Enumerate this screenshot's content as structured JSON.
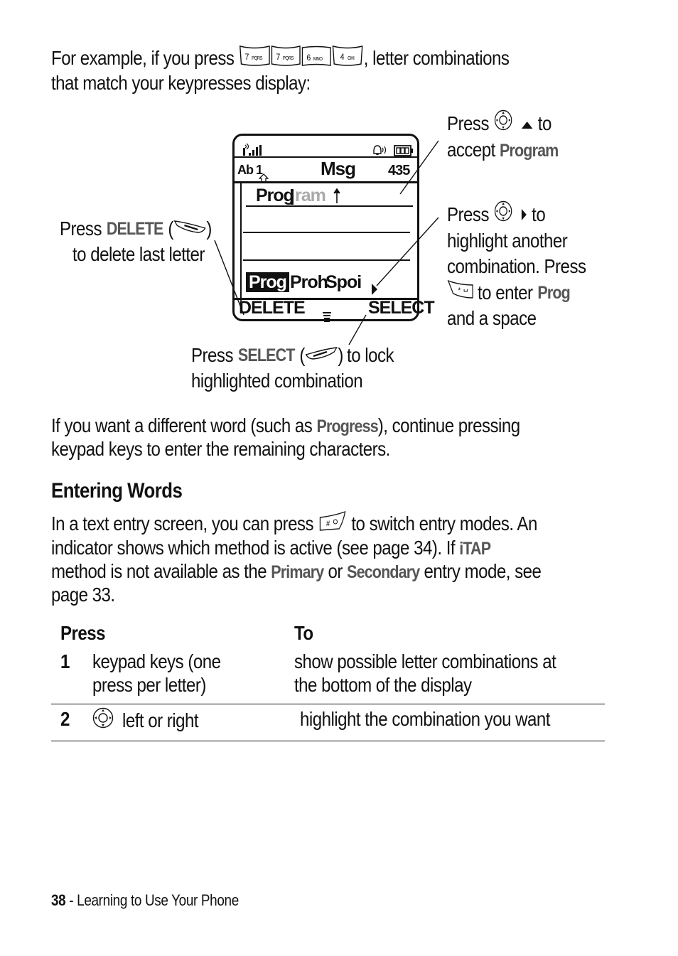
{
  "intro": {
    "before_keys": "For example, if you press",
    "keys": [
      {
        "digit": "7",
        "letters": "PQRS"
      },
      {
        "digit": "7",
        "letters": "PQRS"
      },
      {
        "digit": "6",
        "letters": "MNO"
      },
      {
        "digit": "4",
        "letters": "GHI"
      }
    ],
    "after_keys": ", letter combinations",
    "line2": "that match your keypresses display:"
  },
  "phone_display": {
    "status_right_icons": [
      "ringer-icon",
      "battery-icon"
    ],
    "mode_indicator": "Ab 1",
    "title": "Msg",
    "char_count": "435",
    "entry_typed": "Prog",
    "entry_completion": "ram",
    "combinations": [
      "Prog",
      "Proh",
      "Spoi"
    ],
    "highlighted_combination": "Prog",
    "left_soft_key": "DELETE",
    "right_soft_key": "SELECT"
  },
  "callouts": {
    "accept": {
      "press": "Press",
      "direction_word": "to",
      "line2_prefix": "accept",
      "term": "Program"
    },
    "highlight": {
      "press": "Press",
      "direction_word": "to",
      "line2": "highlight another",
      "line3": "combination. Press",
      "line4_mid": "to enter",
      "term": "Prog",
      "line5": "and a space"
    },
    "delete": {
      "press": "Press",
      "term": "DELETE",
      "line2": "to delete last letter"
    },
    "select": {
      "press": "Press",
      "term": "SELECT",
      "after": "to lock",
      "line2": "highlighted combination"
    }
  },
  "paragraph1": {
    "before": "If you want a different word (such as",
    "term": "Progress",
    "after": "), continue pressing",
    "line2": "keypad keys to enter the remaining characters."
  },
  "section": {
    "title": "Entering Words",
    "line1_before": "In a text entry screen, you can press",
    "line1_after": "to switch entry modes. An",
    "line2_before": "indicator shows which method is active (see page 34). If",
    "term_itap": "iTAP",
    "line3_before": "method is not available as the",
    "term_primary": "Primary",
    "line3_mid": "or",
    "term_secondary": "Secondary",
    "line3_after": "entry mode, see",
    "line4": "page 33."
  },
  "table": {
    "headers": {
      "press": "Press",
      "to": "To"
    },
    "rows": [
      {
        "num": "1",
        "press": "keypad keys (one press per letter)",
        "press_l1": "keypad keys (one",
        "press_l2": "press per letter)",
        "to_l1": "show possible letter combinations at",
        "to_l2": "the bottom of the display"
      },
      {
        "num": "2",
        "press": "left or right",
        "to_l1": "highlight the combination you want"
      }
    ]
  },
  "footer": {
    "page_number": "38",
    "separator": " - ",
    "section": "Learning to Use Your Phone"
  }
}
